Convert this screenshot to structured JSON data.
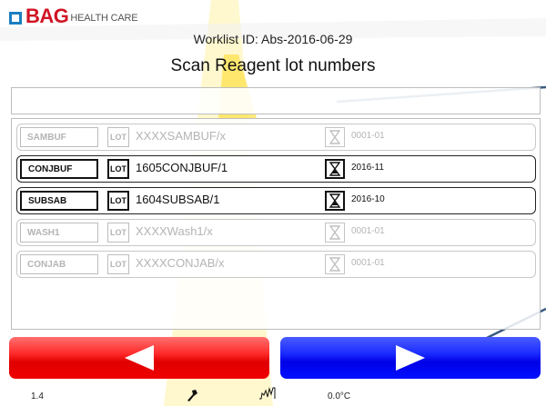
{
  "header": {
    "brand": "BAG",
    "brand_sub": "HEALTH CARE",
    "worklist": "Worklist ID: Abs-2016-06-29",
    "title": "Scan Reagent lot numbers"
  },
  "colors": {
    "brand_red": "#d01424",
    "brand_blue": "#1a7fc1",
    "back_button": "#ff2a2a",
    "next_button": "#1a2bff",
    "background_accent": "#ffe24d"
  },
  "scan_input": {
    "value": ""
  },
  "reagents": [
    {
      "name": "SAMBUF",
      "lot_label": "LOT",
      "lot": "XXXXSAMBUF/x",
      "expiry": "0001-01",
      "active": false,
      "icon": "hourglass-icon"
    },
    {
      "name": "CONJBUF",
      "lot_label": "LOT",
      "lot": "1605CONJBUF/1",
      "expiry": "2016-11",
      "active": true,
      "icon": "hourglass-icon"
    },
    {
      "name": "SUBSAB",
      "lot_label": "LOT",
      "lot": "1604SUBSAB/1",
      "expiry": "2016-10",
      "active": true,
      "icon": "hourglass-icon"
    },
    {
      "name": "WASH1",
      "lot_label": "LOT",
      "lot": "XXXXWash1/x",
      "expiry": "0001-01",
      "active": false,
      "icon": "hourglass-icon"
    },
    {
      "name": "CONJAB",
      "lot_label": "LOT",
      "lot": "XXXXCONJAB/x",
      "expiry": "0001-01",
      "active": false,
      "icon": "hourglass-icon"
    }
  ],
  "buttons": {
    "back_icon": "left-arrow-icon",
    "next_icon": "right-arrow-icon"
  },
  "status_bar": {
    "version": "1.4",
    "tool_icon": "tool-icon",
    "graph_icon": "signal-graph-icon",
    "temperature": "0.0°C"
  }
}
